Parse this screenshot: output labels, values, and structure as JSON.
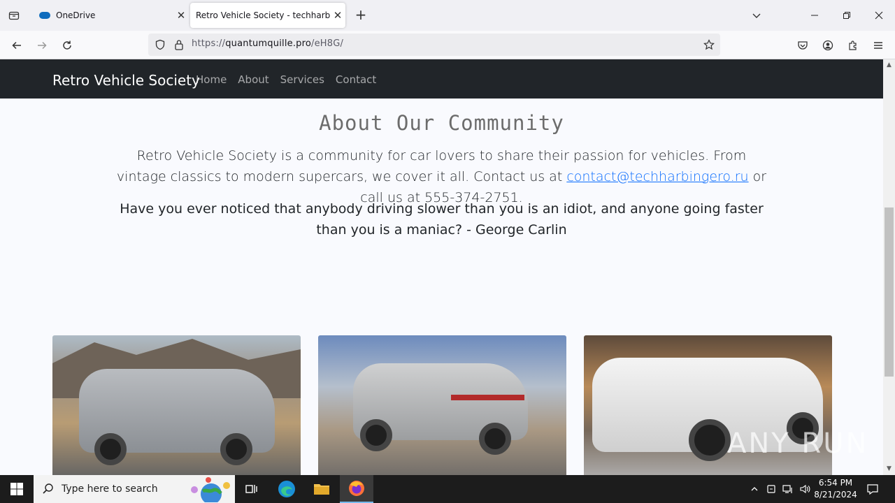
{
  "browser": {
    "tabs": [
      {
        "label": "OneDrive",
        "active": false
      },
      {
        "label": "Retro Vehicle Society - techharbinge",
        "active": true
      }
    ],
    "url_prefix": "https://",
    "url_domain": "quantumquille.pro",
    "url_path": "/eH8G/"
  },
  "site": {
    "brand": "Retro Vehicle Society",
    "nav": [
      "Home",
      "About",
      "Services",
      "Contact"
    ],
    "heading": "About Our Community",
    "intro_before": "Retro Vehicle Society is a community for car lovers to share their passion for vehicles. From vintage classics to modern supercars, we cover it all. Contact us at ",
    "email": "contact@techharbingero.ru",
    "intro_after": " or call us at 555-374-2751.",
    "quote": "Have you ever noticed that anybody driving slower than you is an idiot, and anyone going faster than you is a maniac? - George Carlin"
  },
  "watermark": "ANY RUN",
  "taskbar": {
    "search_placeholder": "Type here to search",
    "time": "6:54 PM",
    "date": "8/21/2024"
  },
  "colors": {
    "site_nav_bg": "#212529",
    "link": "#0d6efd",
    "taskbar_bg": "#1c1c1c"
  }
}
